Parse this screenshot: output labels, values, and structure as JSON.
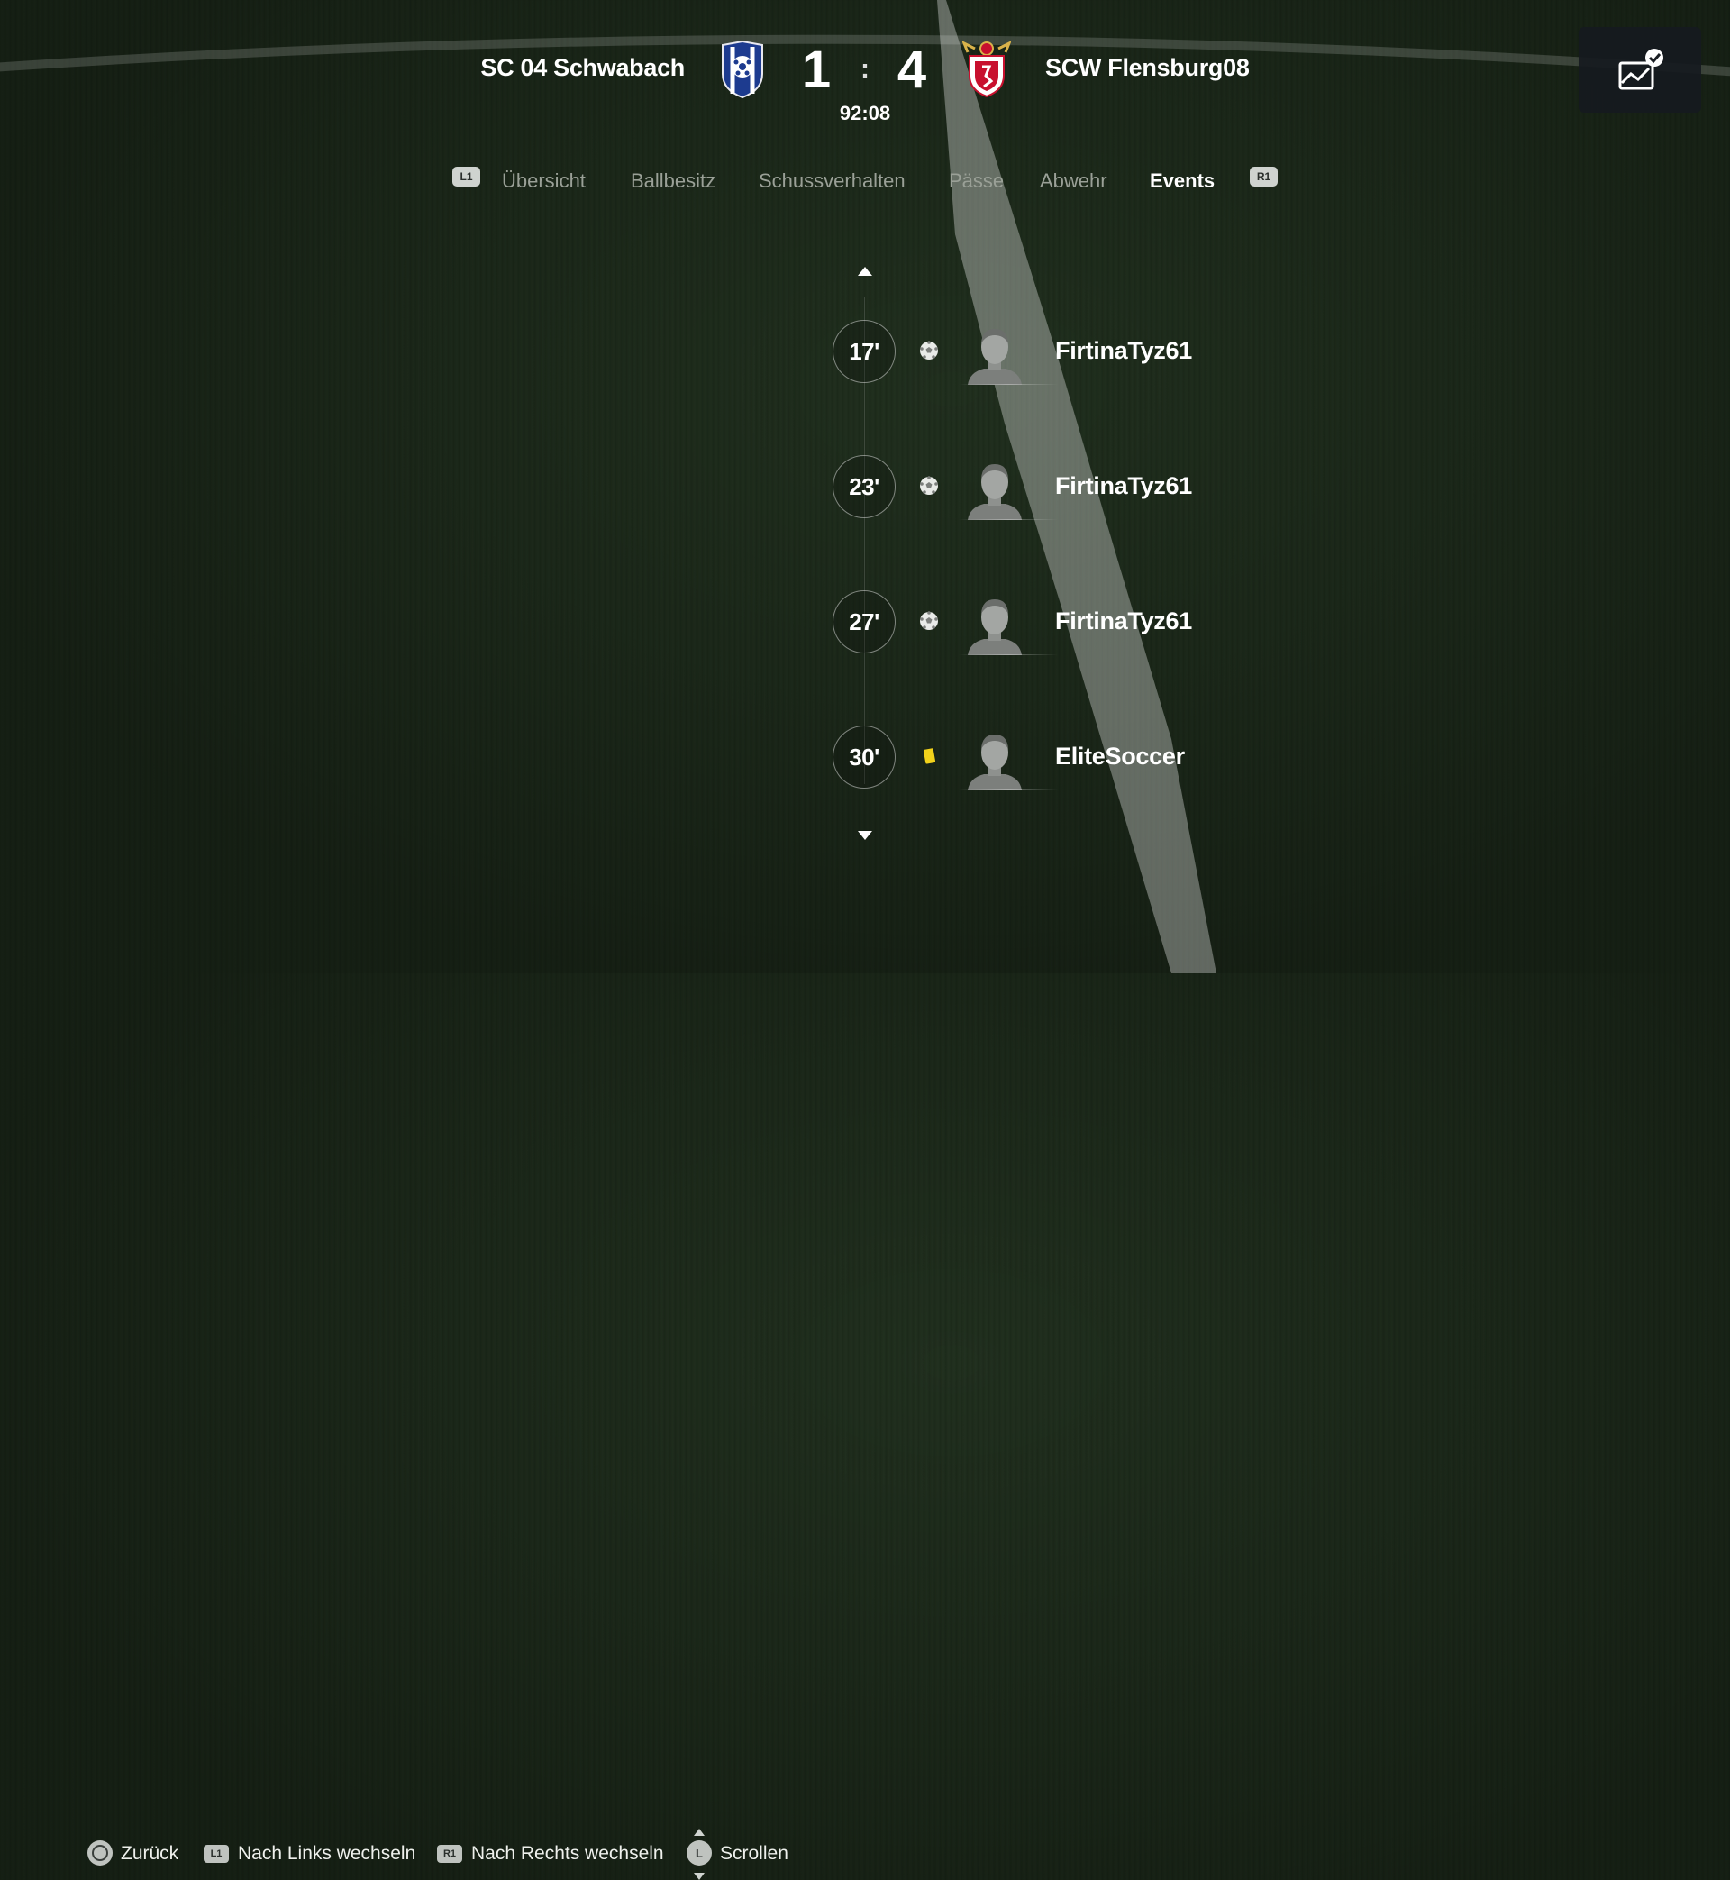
{
  "match": {
    "home_team": "SC 04 Schwabach",
    "away_team": "SCW Flensburg08",
    "home_score": "1",
    "away_score": "4",
    "separator": ":",
    "clock": "92:08"
  },
  "tabs": {
    "l1_badge": "L1",
    "r1_badge": "R1",
    "items": [
      {
        "label": "Übersicht"
      },
      {
        "label": "Ballbesitz"
      },
      {
        "label": "Schussverhalten"
      },
      {
        "label": "Pässe"
      },
      {
        "label": "Abwehr"
      },
      {
        "label": "Events"
      }
    ],
    "active": "Events"
  },
  "events": [
    {
      "minute": "17'",
      "type": "goal",
      "icon": "ball-icon",
      "player": "FirtinaTyz61"
    },
    {
      "minute": "23'",
      "type": "goal",
      "icon": "ball-icon",
      "player": "FirtinaTyz61"
    },
    {
      "minute": "27'",
      "type": "goal",
      "icon": "ball-icon",
      "player": "FirtinaTyz61"
    },
    {
      "minute": "30'",
      "type": "yellow-card",
      "icon": "yellow-card-icon",
      "player": "EliteSoccer"
    }
  ],
  "footer": {
    "back": "Zurück",
    "l1_badge": "L1",
    "left": "Nach Links wechseln",
    "r1_badge": "R1",
    "right": "Nach Rechts wechseln",
    "stick_badge": "L",
    "scroll": "Scrollen"
  },
  "colors": {
    "active_tab": "#ffffff",
    "inactive_tab": "#9aa097",
    "yellow_card": "#f2d21b",
    "home_crest": "#1d3b8f",
    "away_crest": "#c8102e"
  }
}
